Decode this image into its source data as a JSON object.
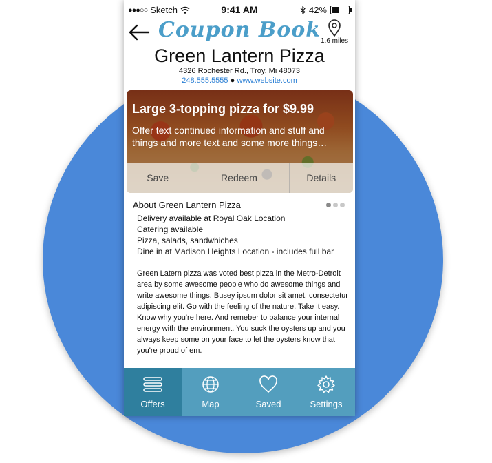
{
  "status_bar": {
    "carrier": "Sketch",
    "signal_dots": "●●●○○",
    "time": "9:41 AM",
    "battery": "42%"
  },
  "header": {
    "app_logo": "Coupon Book",
    "distance": "1.6 miles"
  },
  "business": {
    "name": "Green Lantern Pizza",
    "address": "4326 Rochester Rd., Troy, Mi 48073",
    "phone": "248.555.5555",
    "separator": "●",
    "website": "www.website.com"
  },
  "offer": {
    "headline": "Large 3-topping pizza for $9.99",
    "description": "Offer text continued information and stuff and things and more text and some more things…",
    "actions": {
      "save": "Save",
      "redeem": "Redeem",
      "details": "Details"
    }
  },
  "about": {
    "title": "About Green Lantern Pizza",
    "features": [
      "Delivery available at Royal Oak Location",
      "Catering available",
      "Pizza, salads, sandwhiches",
      "Dine in at Madison Heights Location - includes full bar"
    ],
    "body": "Green Latern pizza was voted best pizza in the Metro-Detroit area by some awesome people who do awesome things and write awesome things. Busey ipsum dolor sit amet, consectetur adipiscing elit. Go with the feeling of the nature. Take it easy. Know why you're here. And remeber to balance your internal energy with the environment. You suck the oysters up and you always keep some on your face to let the oysters know that you're proud of em."
  },
  "tabs": {
    "offers": "Offers",
    "map": "Map",
    "saved": "Saved",
    "settings": "Settings"
  },
  "colors": {
    "background_circle": "#4a88d9",
    "logo": "#4b9ec9",
    "tabbar": "#4496b8",
    "tab_active": "#2f7f9e",
    "link": "#2a7fd4"
  },
  "icons": [
    "wifi-icon",
    "bluetooth-icon",
    "battery-icon",
    "back-arrow-icon",
    "location-pin-icon",
    "menu-icon",
    "globe-icon",
    "heart-icon",
    "gear-icon"
  ]
}
